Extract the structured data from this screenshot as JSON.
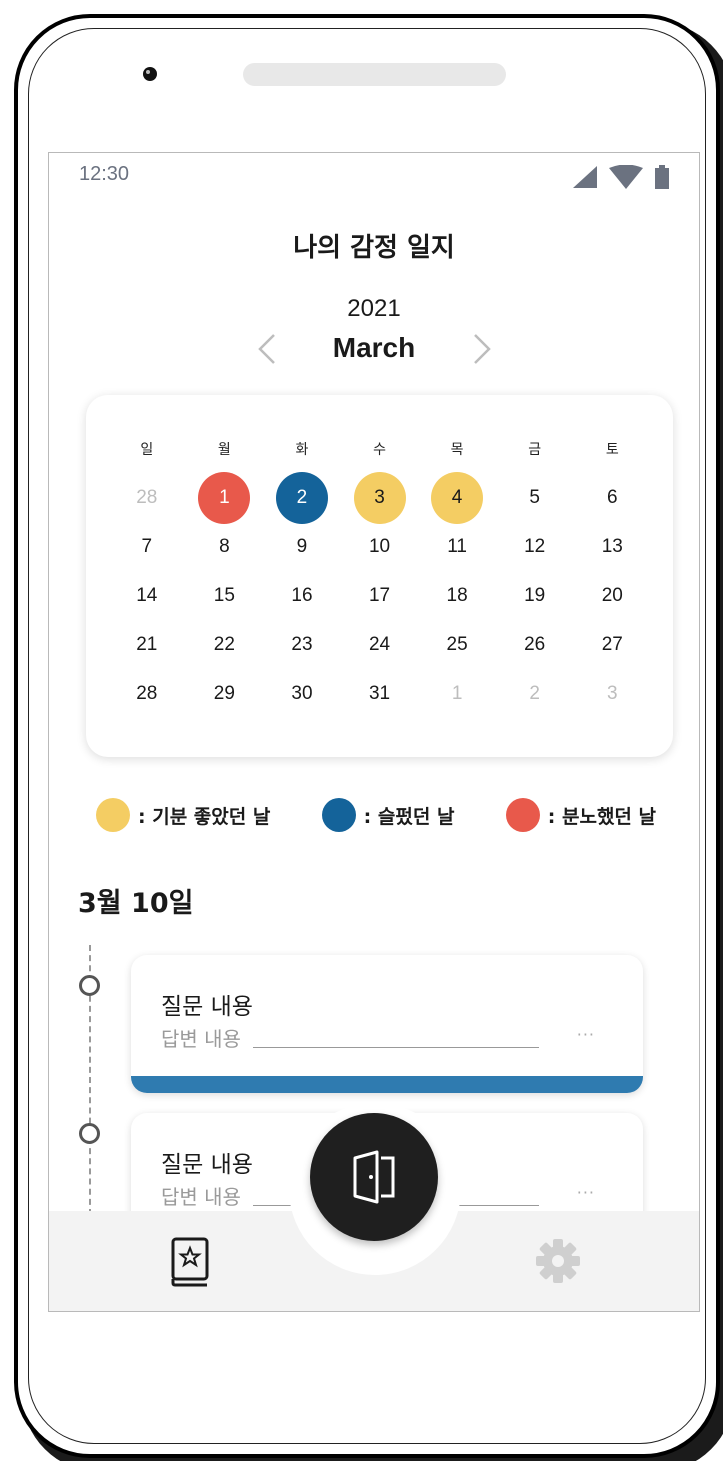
{
  "status": {
    "time": "12:30"
  },
  "app": {
    "title": "나의 감정 일지"
  },
  "calendar": {
    "year": "2021",
    "month": "March",
    "weekdays": [
      "일",
      "월",
      "화",
      "수",
      "목",
      "금",
      "토"
    ],
    "weeks": [
      [
        "28",
        "1",
        "2",
        "3",
        "4",
        "5",
        "6"
      ],
      [
        "7",
        "8",
        "9",
        "10",
        "11",
        "12",
        "13"
      ],
      [
        "14",
        "15",
        "16",
        "17",
        "18",
        "19",
        "20"
      ],
      [
        "21",
        "22",
        "23",
        "24",
        "25",
        "26",
        "27"
      ],
      [
        "28",
        "29",
        "30",
        "31",
        "1",
        "2",
        "3"
      ]
    ],
    "emotion_marks": {
      "1": "anger",
      "2": "sad",
      "3": "happy",
      "4": "happy"
    }
  },
  "legend": {
    "happy": {
      "label": ": 기분 좋았던 날",
      "color": "#f4cd63"
    },
    "sad": {
      "label": ": 슬펐던 날",
      "color": "#14639a"
    },
    "anger": {
      "label": ": 분노했던 날",
      "color": "#e8594b"
    }
  },
  "entries": {
    "date": "3월 10일",
    "items": [
      {
        "question": "질문 내용",
        "answer": "답변 내용",
        "more": "···"
      },
      {
        "question": "질문 내용",
        "answer": "답변 내용",
        "more": "···"
      }
    ]
  },
  "icons": {
    "prev": "chevron-left-icon",
    "next": "chevron-right-icon",
    "fab": "door-icon",
    "diary": "diary-star-icon",
    "settings": "gear-icon"
  }
}
